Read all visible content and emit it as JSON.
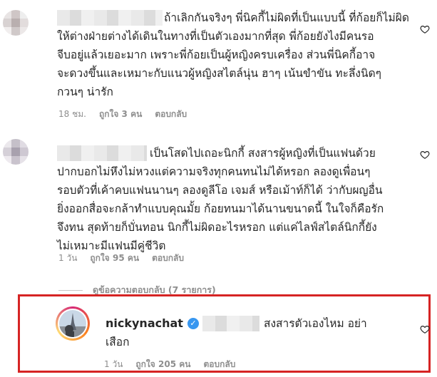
{
  "comments": [
    {
      "text": "ถ้าเลิกกันจริงๆ พี่นิคกี้ไม่ผิดที่เป็นแบบนี้ ที่ก้อยก็ไม่ผิด\nให้ต่างฝ่ายต่างได้เดินในทางที่เป็นตัวเองมากที่สุด พี่ก้อยยังไงมีคนรอ\nจีบอยู่แล้วเยอะมาก เพราะพี่ก้อยเป็นผู้หญิงครบเครื่อง ส่วนพี่นิคกี้อาจ\nจะดวงขึ้นและเหมาะกับแนวผู้หญิงสไตล์นุ่น ฮาๆ เน้นขำขัน ทะลึ่งนิดๆ\nกวนๆ น่ารัก",
      "time": "18 ชม.",
      "likes": "ถูกใจ 3 คน",
      "reply": "ตอบกลับ"
    },
    {
      "text": "เป็นโสดไปเถอะนิกกี้ สงสารผู้หญิงที่เป็นแฟนด้วย\nปากบอกไม่หึงไม่หวงแต่ความจริงทุกคนทนไม่ได้หรอก ลองดูเพื่อนๆ\nรอบตัวที่เค้าคบแฟนนานๆ ลองดูลีโอ เจมส์ หรือเม้าท์ก็ได้ ว่ากับผญอื่น\nยิ่งออกสื่อจะกล้าทำแบบคุณมั้ย ก้อยทนมาได้นานขนาดนี้ ในใจก็คือรัก\nจึงทน สุดท้ายก็บั่นทอน นิกกี้ไม่ผิดอะไรหรอก แต่แค่ไลฟ์สไตล์นิกกี้ยัง\nไม่เหมาะมีแฟนมีคู่ชีวิต",
      "time": "1 วัน",
      "likes": "ถูกใจ 95 คน",
      "reply": "ตอบกลับ"
    }
  ],
  "view_replies": "ดูข้อความตอบกลับ (7 รายการ)",
  "reply_comment": {
    "username": "nickynachat",
    "text": "สงสารตัวเองไหม อย่า\nเสือก",
    "time": "1 วัน",
    "likes": "ถูกใจ 205 คน",
    "reply": "ตอบกลับ"
  },
  "icons": {
    "like": "heart-outline-icon",
    "verified": "verified-badge-icon"
  },
  "colors": {
    "highlight_border": "#d62424",
    "verified": "#3897f0",
    "meta_text": "#8e8e8e"
  }
}
